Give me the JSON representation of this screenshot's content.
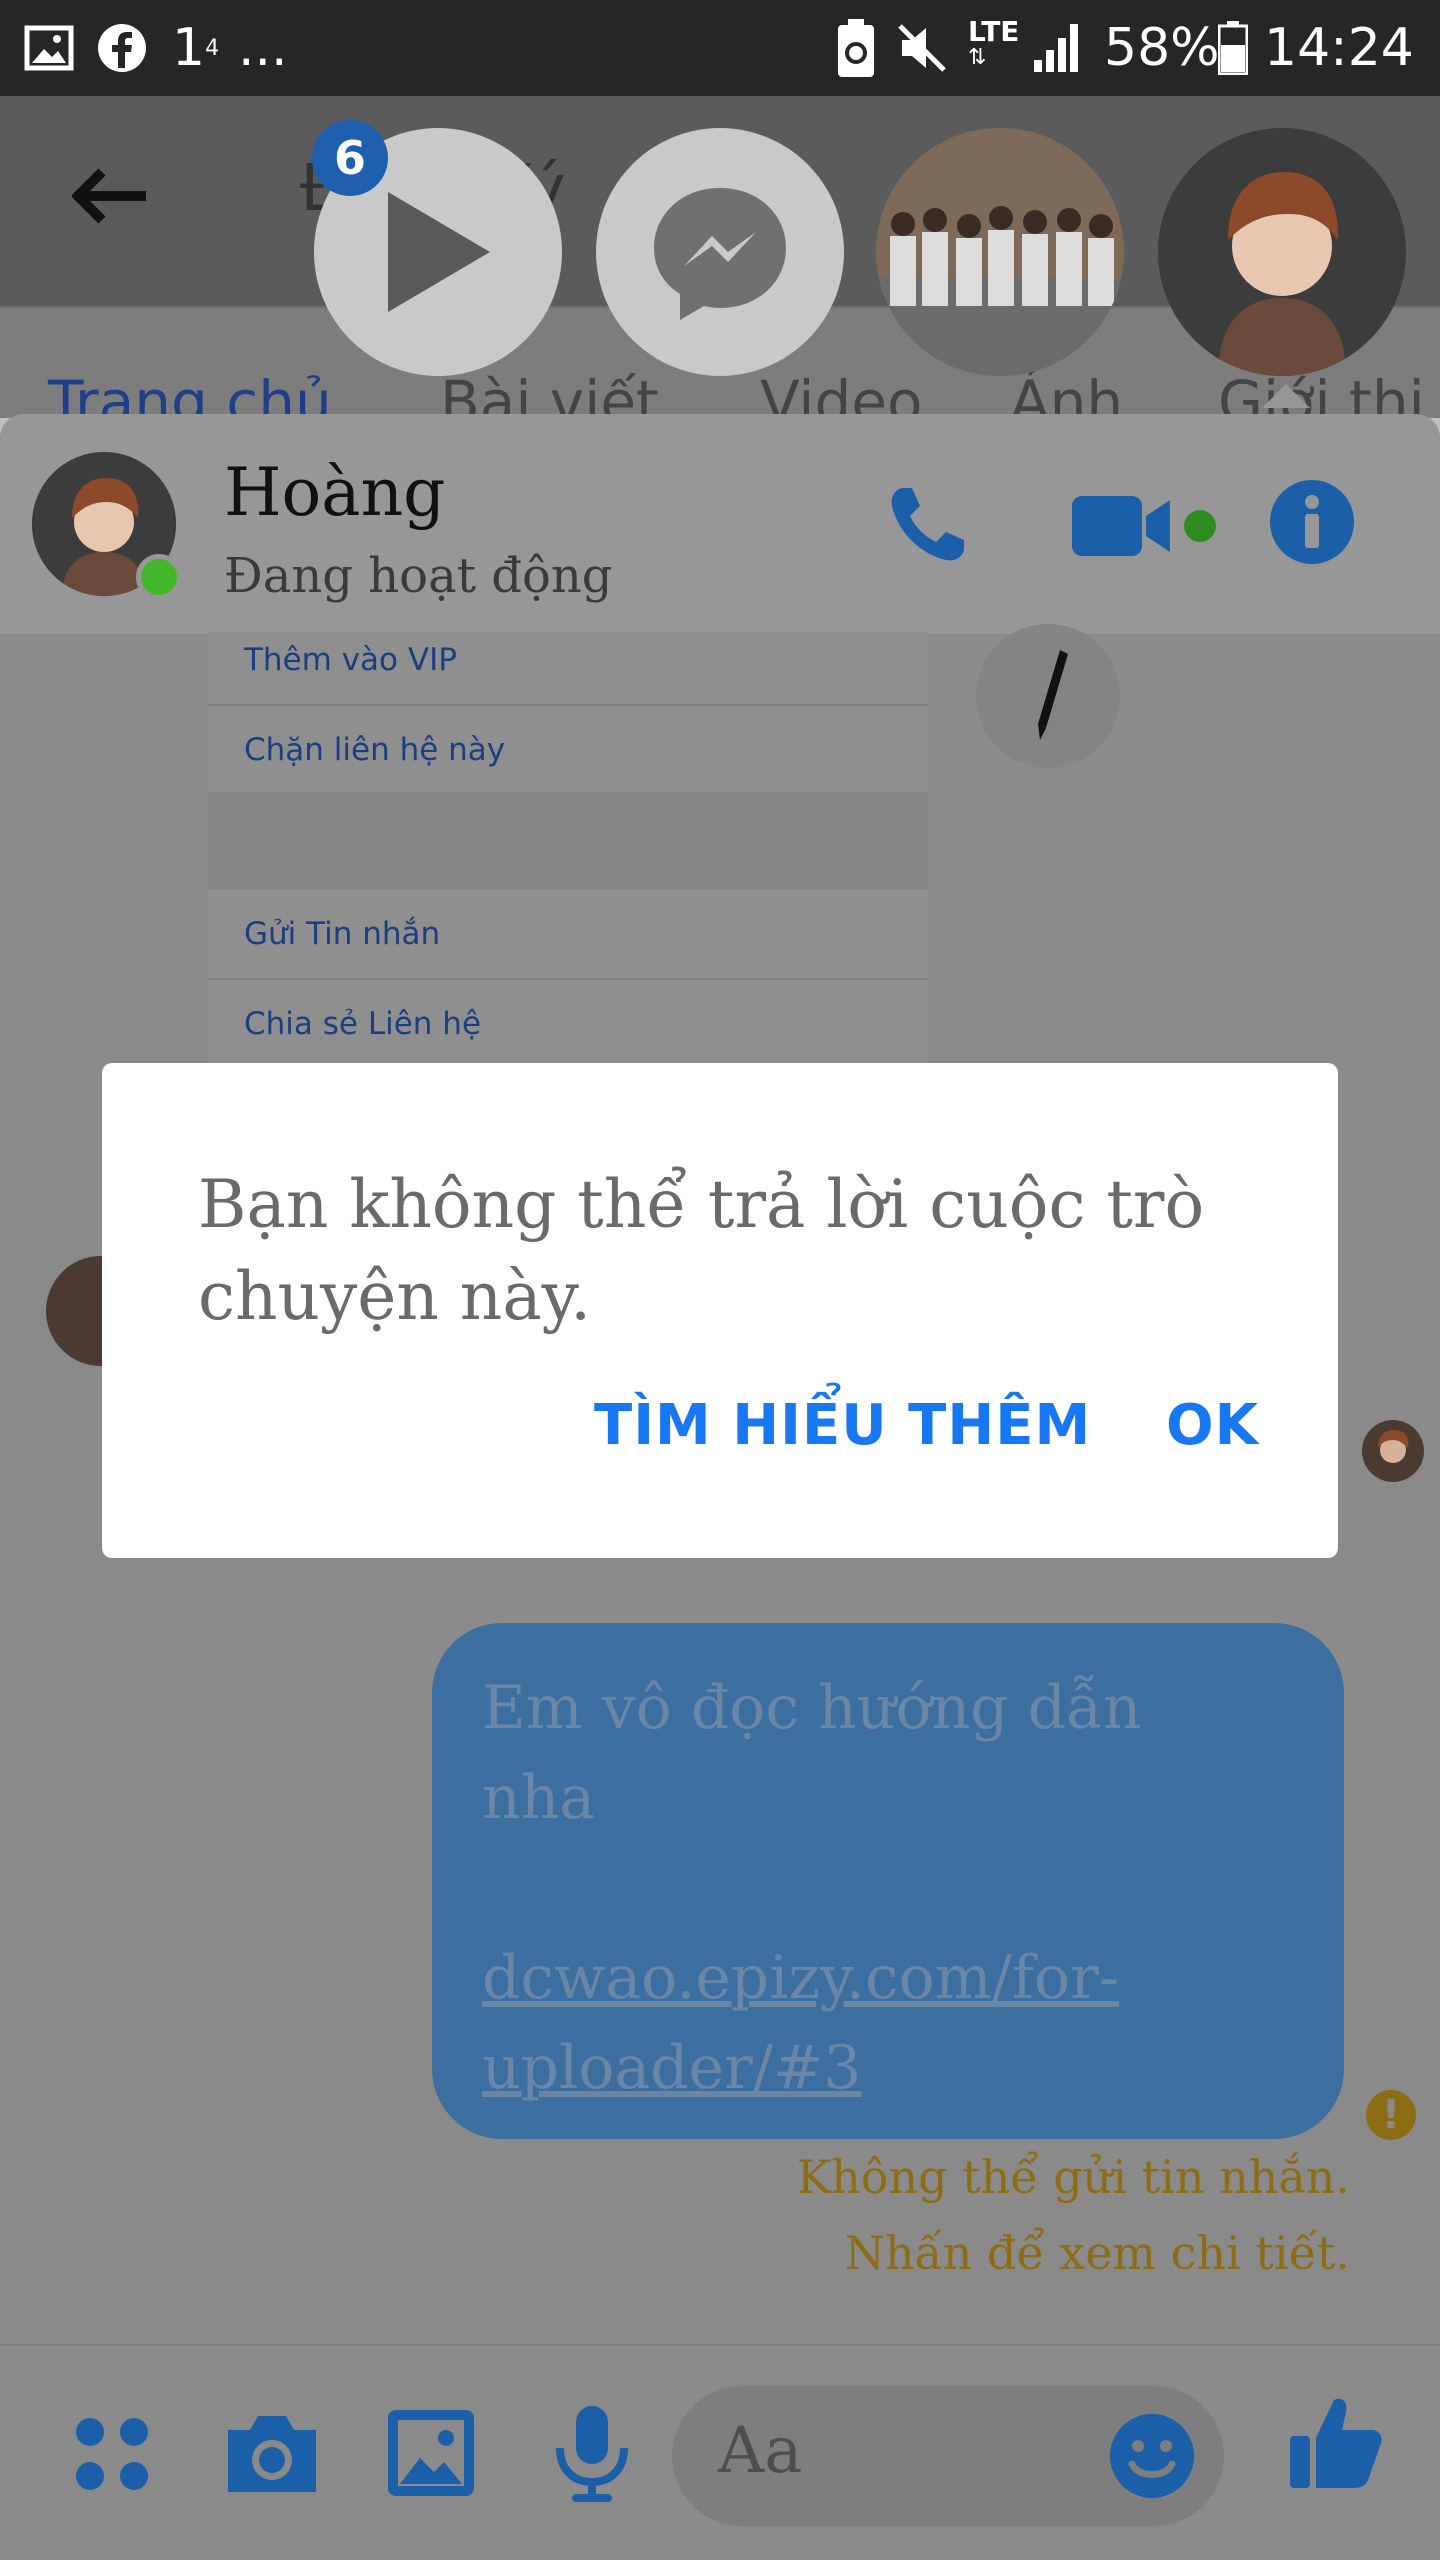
{
  "status_bar": {
    "notif_text": "1",
    "notif_sup": "4",
    "more": "...",
    "network": "LTE",
    "battery": "58%",
    "time": "14:24"
  },
  "background_page": {
    "title": "Đăng Ký",
    "tabs": [
      "Trang chủ",
      "Bài viết",
      "Video",
      "Ảnh",
      "Giới thi"
    ]
  },
  "chat_heads": {
    "badge_count": "6"
  },
  "chat_header": {
    "name": "Hoàng",
    "status": "Đang hoạt động"
  },
  "background_menu": {
    "items": [
      "Thêm vào VIP",
      "Chặn liên hệ này",
      "Gửi Tin nhắn",
      "Chia sẻ Liên hệ"
    ]
  },
  "dialog": {
    "message": "Bạn không thể trả lời cuộc trò chuyện này.",
    "learn_more": "TÌM HIỂU THÊM",
    "ok": "OK"
  },
  "message": {
    "line1": "Em vô đọc hướng dẫn",
    "line2": "nha",
    "link1": "dcwao.epizy.com/for-",
    "link2": "uploader/#3"
  },
  "send_error": {
    "line1": "Không thể gửi tin nhắn.",
    "line2": "Nhấn để xem chi tiết."
  },
  "composer": {
    "placeholder": "Aa"
  },
  "colors": {
    "accent": "#1877f2",
    "online": "#42b72a",
    "error": "#f0b400"
  }
}
